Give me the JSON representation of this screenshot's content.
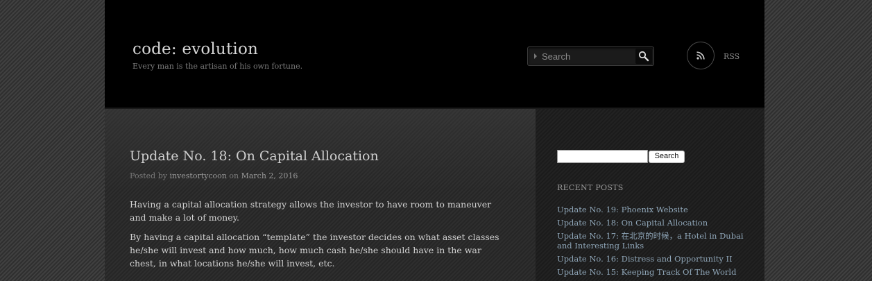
{
  "header": {
    "site_title": "code: evolution",
    "tagline": "Every man is the artisan of his own fortune.",
    "search_placeholder": "Search",
    "rss_label": "RSS"
  },
  "post": {
    "title": "Update No. 18: On Capital Allocation",
    "meta_prefix": "Posted by",
    "author": "investortycoon",
    "meta_on": "on",
    "date": "March 2, 2016",
    "paragraphs": [
      "Having a capital allocation strategy allows the investor to have room to maneuver and make a lot of money.",
      "By having a capital allocation “template” the investor decides on what asset classes he/she will invest and how much, how much cash he/she should have in the war chest, in what locations he/she will invest, etc."
    ]
  },
  "sidebar": {
    "search_value": "",
    "search_button": "Search",
    "recent_heading": "RECENT POSTS",
    "recent_posts": [
      "Update No. 19: Phoenix Website",
      "Update No. 18: On Capital Allocation",
      "Update No. 17: 在北京的时候，a Hotel in Dubai and Interesting Links",
      "Update No. 16: Distress and Opportunity II",
      "Update No. 15: Keeping Track Of The World"
    ]
  },
  "icons": {
    "search": "search-icon",
    "rss": "rss-icon",
    "input_arrow": "caret-right-icon"
  },
  "colors": {
    "header_bg": "#000000",
    "link_blue": "#8fa6b8",
    "title_text": "#d6d6d6"
  }
}
